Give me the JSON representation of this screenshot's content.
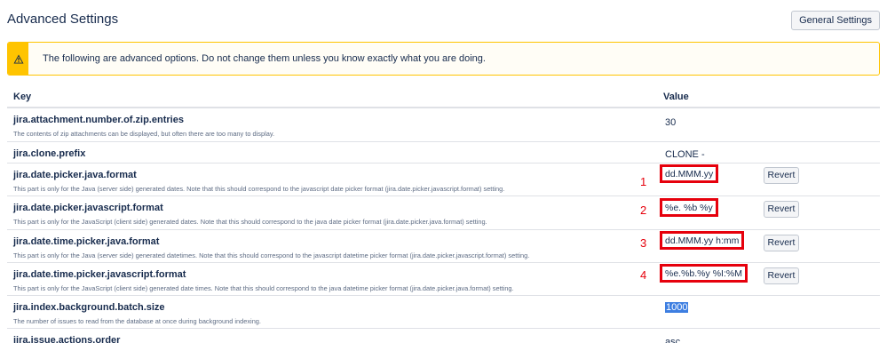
{
  "header": {
    "title": "Advanced Settings",
    "general_settings_label": "General Settings"
  },
  "warning": {
    "icon": "warning-triangle-icon",
    "text": "The following are advanced options. Do not change them unless you know exactly what you are doing."
  },
  "table": {
    "columns": {
      "key": "Key",
      "value": "Value"
    },
    "rows": [
      {
        "name": "jira.attachment.number.of.zip.entries",
        "description": "The contents of zip attachments can be displayed, but often there are too many to display.",
        "value": "30"
      },
      {
        "name": "jira.clone.prefix",
        "description": "",
        "value": "CLONE -"
      },
      {
        "name": "jira.date.picker.java.format",
        "description": "This part is only for the Java (server side) generated dates. Note that this should correspond to the javascript date picker format (jira.date.picker.javascript.format) setting.",
        "value": "dd.MMM.yy",
        "annotation": "1",
        "revert_label": "Revert"
      },
      {
        "name": "jira.date.picker.javascript.format",
        "description": "This part is only for the JavaScript (client side) generated dates. Note that this should correspond to the java date picker format (jira.date.picker.java.format) setting.",
        "value": "%e. %b %y",
        "annotation": "2",
        "revert_label": "Revert"
      },
      {
        "name": "jira.date.time.picker.java.format",
        "description": "This part is only for the Java (server side) generated datetimes. Note that this should correspond to the javascript datetime picker format (jira.date.picker.javascript.format) setting.",
        "value": "dd.MMM.yy h:mm",
        "annotation": "3",
        "revert_label": "Revert"
      },
      {
        "name": "jira.date.time.picker.javascript.format",
        "description": "This part is only for the JavaScript (client side) generated date times. Note that this should correspond to the java datetime picker format (jira.date.picker.java.format) setting.",
        "value": "%e.%b.%y %I:%M",
        "annotation": "4",
        "revert_label": "Revert"
      },
      {
        "name": "jira.index.background.batch.size",
        "description": "The number of issues to read from the database at once during background indexing.",
        "value": "1000"
      },
      {
        "name": "jira.issue.actions.order",
        "description": "",
        "value": "asc"
      }
    ]
  },
  "colors": {
    "annotation_red": "#e6000c",
    "warning_yellow": "#ffc400",
    "selection_blue": "#3d7ee1"
  }
}
